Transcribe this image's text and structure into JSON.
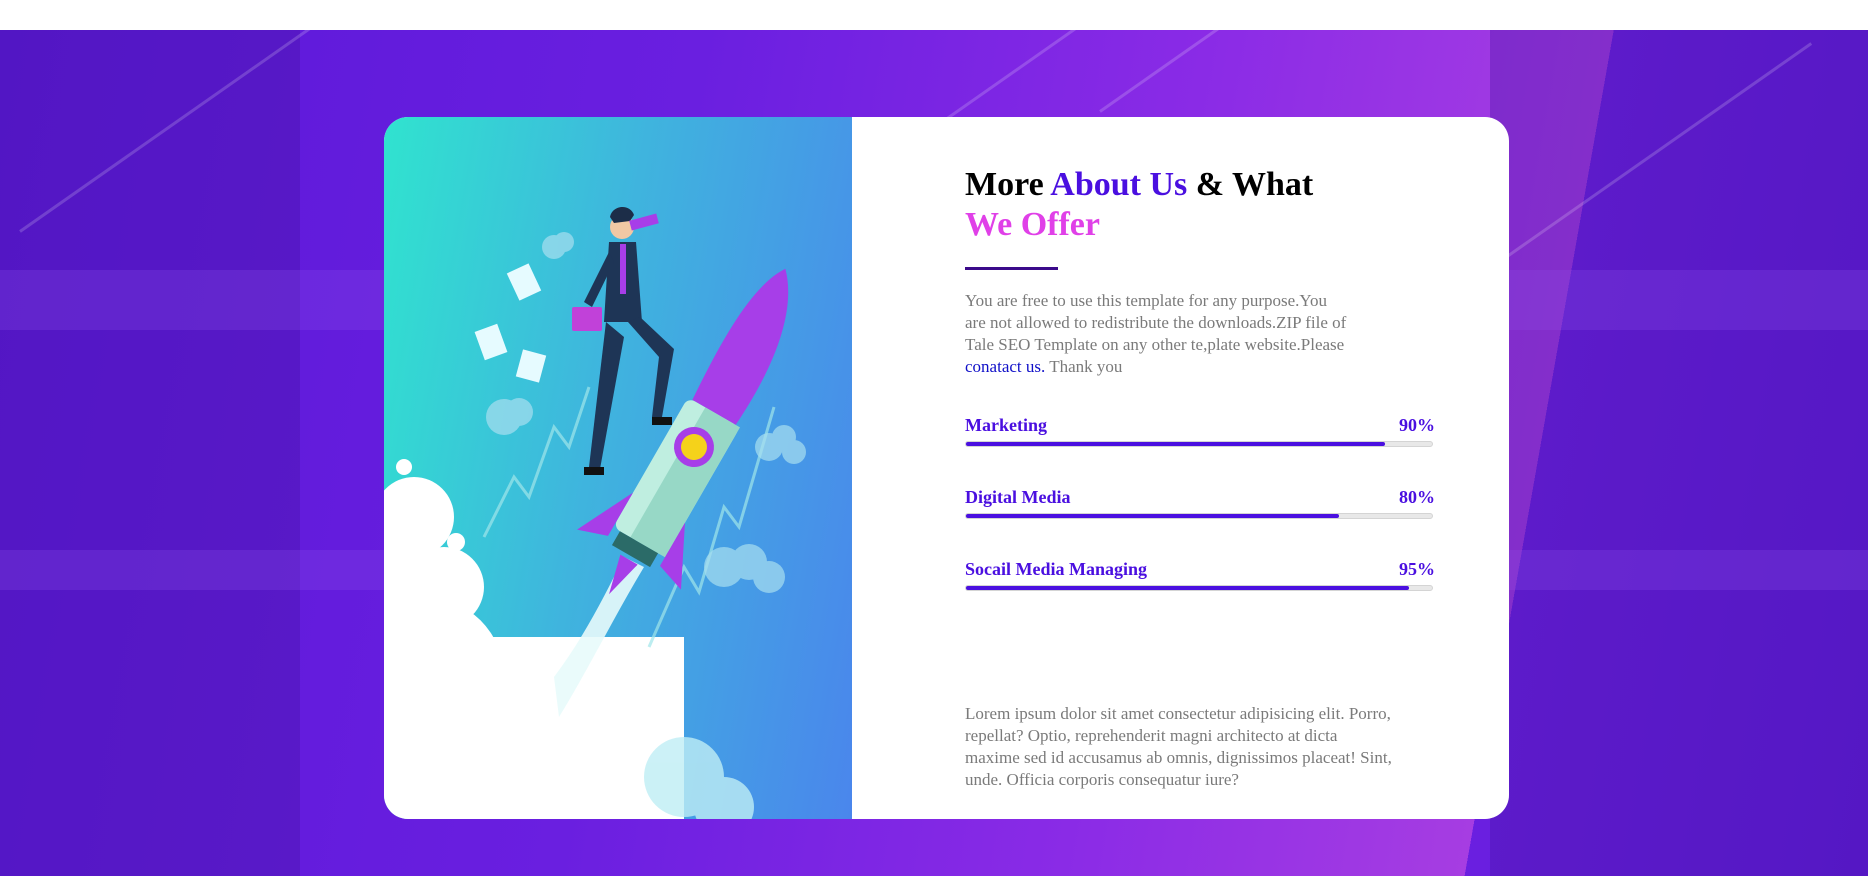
{
  "heading": {
    "part1": "More ",
    "part2": "About Us",
    "part3": " & What",
    "part4": "We Offer"
  },
  "description": {
    "text_before": "You are free to use this template for any purpose.You are not allowed to redistribute the downloads.ZIP file of Tale SEO Template on any other te,plate website.Please ",
    "link": "conatact us.",
    "text_after": " Thank you"
  },
  "skills": [
    {
      "label": "Marketing",
      "percent_label": "90%",
      "value": 0.9
    },
    {
      "label": "Digital Media",
      "percent_label": "80%",
      "value": 0.8
    },
    {
      "label": "Socail Media Managing",
      "percent_label": "95%",
      "value": 0.95
    }
  ],
  "lorem": "Lorem ipsum dolor sit amet consectetur adipisicing elit. Porro, repellat? Optio, reprehenderit magni architecto at dicta maxime sed id accusamus ab omnis, dignissimos placeat! Sint, unde. Officia corporis consequatur iure?",
  "colors": {
    "accent_primary": "#4a0fe0",
    "accent_secondary": "#e040e8",
    "background_purple": "#6a1fe0"
  }
}
